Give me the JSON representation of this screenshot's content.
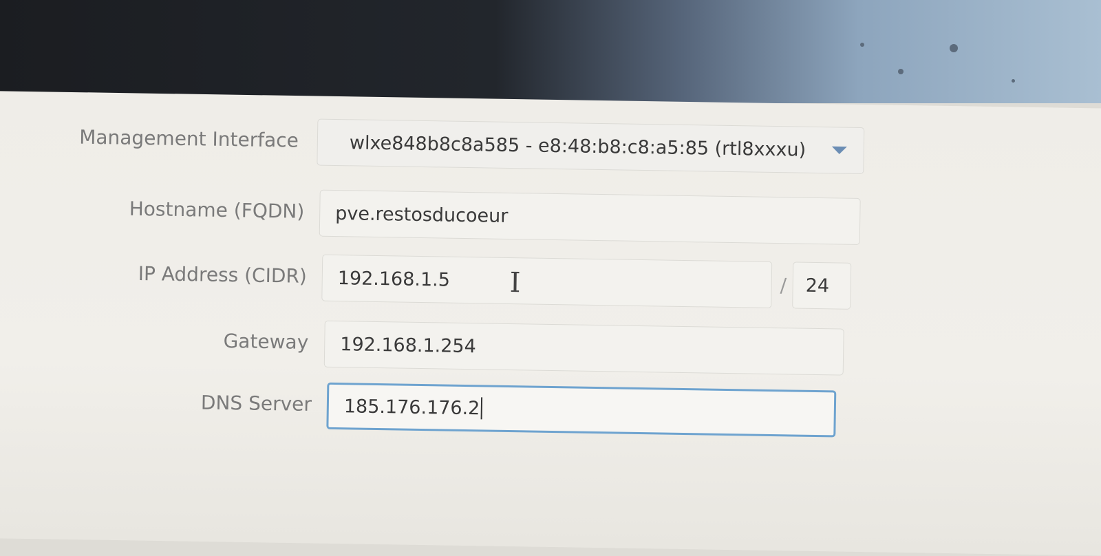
{
  "form": {
    "management_interface": {
      "label": "Management Interface",
      "value": "wlxe848b8c8a585 - e8:48:b8:c8:a5:85 (rtl8xxxu)"
    },
    "hostname": {
      "label": "Hostname (FQDN)",
      "value": "pve.restosducoeur"
    },
    "ip_address": {
      "label": "IP Address (CIDR)",
      "value": "192.168.1.5",
      "separator": "/",
      "cidr": "24"
    },
    "gateway": {
      "label": "Gateway",
      "value": "192.168.1.254"
    },
    "dns_server": {
      "label": "DNS Server",
      "value": "185.176.176.2"
    }
  },
  "colors": {
    "focus_border": "#6ea3cf",
    "caret": "#6b8db4",
    "label": "#7a7a7a"
  },
  "icons": {
    "dropdown": "chevron-down-icon",
    "cursor": "text-cursor-icon"
  }
}
